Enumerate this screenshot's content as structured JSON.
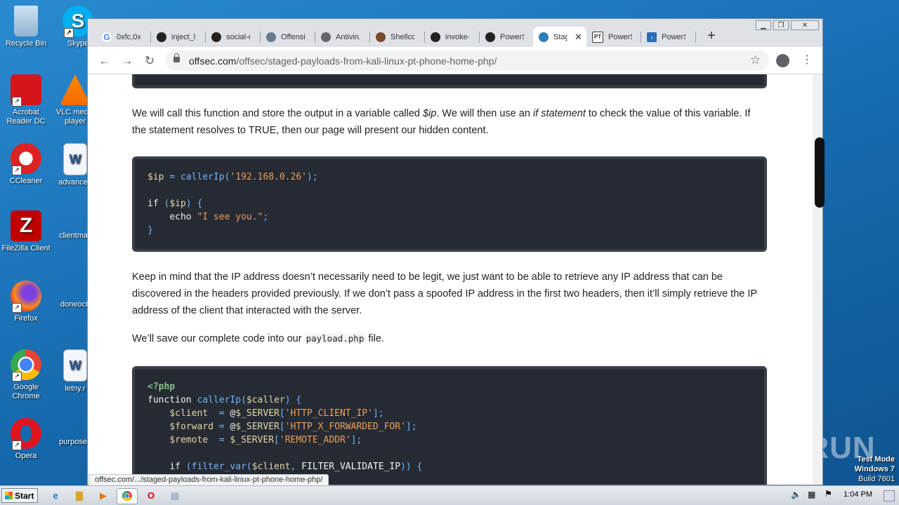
{
  "desktop": {
    "icons": [
      {
        "label": "Recycle Bin"
      },
      {
        "label": "Skype"
      },
      {
        "label": "Acrobat Reader DC"
      },
      {
        "label": "VLC media player"
      },
      {
        "label": "CCleaner"
      },
      {
        "label": "advanced"
      },
      {
        "label": "FileZilla Client"
      },
      {
        "label": "clientmail"
      },
      {
        "label": "Firefox"
      },
      {
        "label": "doneoct."
      },
      {
        "label": "Google Chrome"
      },
      {
        "label": "letny.r"
      },
      {
        "label": "Opera"
      },
      {
        "label": "purposed"
      }
    ],
    "watermark": "ANY RUN",
    "test_mode": {
      "line1": "Test Mode",
      "line2": "Windows 7",
      "line3": "Build 7601"
    }
  },
  "browser": {
    "tabs": [
      {
        "title": "0xfc,0x",
        "icon": "google-icon"
      },
      {
        "title": "inject_lo",
        "icon": "github-icon"
      },
      {
        "title": "social-e",
        "icon": "github-icon"
      },
      {
        "title": "Offensi",
        "icon": "offsec-icon"
      },
      {
        "title": "Antiviru",
        "icon": "globe-icon"
      },
      {
        "title": "Shellcod",
        "icon": "shellcode-icon"
      },
      {
        "title": "invoke-",
        "icon": "github-icon"
      },
      {
        "title": "PowerSh",
        "icon": "github-icon"
      },
      {
        "title": "Stag",
        "icon": "offsec-icon",
        "active": true
      },
      {
        "title": "PowerSh",
        "icon": "pt-icon"
      },
      {
        "title": "PowerSh",
        "icon": "powershell-icon"
      }
    ],
    "url_host": "offsec.com",
    "url_path": "/offsec/staged-payloads-from-kali-linux-pt-phone-home-php/",
    "status_url": "offsec.com/.../staged-payloads-from-kali-linux-pt-phone-home-php/"
  },
  "article": {
    "p1_a": "We will call this function and store the output in a variable called ",
    "p1_em1": "$ip",
    "p1_b": ". We will then use an ",
    "p1_em2": "if statement",
    "p1_c": " to check the value of this variable. If the statement resolves to TRUE, then our page will present our hidden content.",
    "p2": "Keep in mind that the IP address doesn’t necessarily need to be legit, we just want to be able to retrieve any IP address that can be discovered in the headers provided previously. If we don’t pass a spoofed IP address in the first two headers, then it’ll simply retrieve the IP address of the client that interacted with the server.",
    "p3_a": "We’ll save our complete code into our ",
    "p3_code": "payload.php",
    "p3_b": " file."
  },
  "taskbar": {
    "start": "Start",
    "clock": "1:04 PM"
  }
}
